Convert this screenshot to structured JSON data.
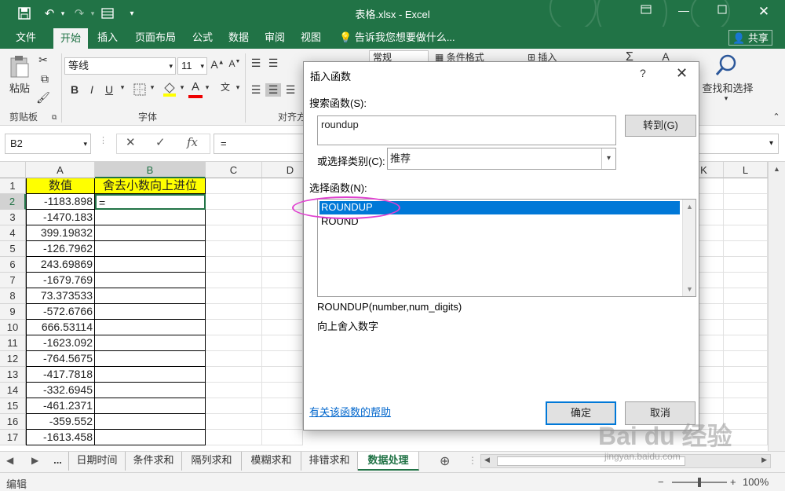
{
  "app": {
    "title": "表格.xlsx - Excel",
    "colors": {
      "brand": "#217346",
      "selection": "#0078d7",
      "highlight": "#ffff00",
      "annotation": "#e040d0"
    }
  },
  "qat": {
    "save_icon": "save-icon",
    "undo_icon": "undo-icon",
    "redo_icon": "redo-icon",
    "form_icon": "form-icon",
    "customize_icon": "chevron-down-icon"
  },
  "ribbon_tabs": [
    "文件",
    "开始",
    "插入",
    "页面布局",
    "公式",
    "数据",
    "审阅",
    "视图"
  ],
  "tell_me": "告诉我您想要做什么...",
  "share": "共享",
  "ribbon": {
    "paste_label": "粘贴",
    "clipboard_label": "剪贴板",
    "font_name": "等线",
    "font_size": "11",
    "bold": "B",
    "italic": "I",
    "underline": "U",
    "font_group_label": "字体",
    "align_group_label": "对齐方",
    "number_format": "常规",
    "cond_format": "条件格式",
    "insert": "插入",
    "find_select": "查找和选择",
    "font_color_label": "A",
    "phonetic": "文"
  },
  "formula_bar": {
    "name_box": "B2",
    "formula": "=",
    "fx": "fx"
  },
  "columns": [
    "A",
    "B",
    "C",
    "D",
    "K",
    "L"
  ],
  "rows": [
    "1",
    "2",
    "3",
    "4",
    "5",
    "6",
    "7",
    "8",
    "9",
    "10",
    "11",
    "12",
    "13",
    "14",
    "15",
    "16",
    "17"
  ],
  "cells": {
    "A1": "数值",
    "B1": "舍去小数向上进位",
    "B2": "=",
    "A_values": [
      "-1183.898",
      "-1470.183",
      "399.19832",
      "-126.7962",
      "243.69869",
      "-1679.769",
      "73.373533",
      "-572.6766",
      "666.53114",
      "-1623.092",
      "-764.5675",
      "-417.7818",
      "-332.6945",
      "-461.2371",
      "-359.552",
      "-1613.458"
    ]
  },
  "sheet_tabs": [
    "日期时间",
    "条件求和",
    "隔列求和",
    "模糊求和",
    "排错求和",
    "数据处理"
  ],
  "sheet_more": "...",
  "status": {
    "mode": "编辑",
    "zoom": "100%"
  },
  "dialog": {
    "title": "插入函数",
    "help": "?",
    "search_label": "搜索函数(S):",
    "search_value": "roundup",
    "goto": "转到(G)",
    "category_label": "或选择类别(C):",
    "category_value": "推荐",
    "func_label": "选择函数(N):",
    "functions": [
      "ROUNDUP",
      "ROUND"
    ],
    "signature": "ROUNDUP(number,num_digits)",
    "description": "向上舍入数字",
    "help_link": "有关该函数的帮助",
    "ok": "确定",
    "cancel": "取消"
  },
  "watermark": {
    "brand": "Bai du 经验",
    "url": "jingyan.baidu.com"
  }
}
